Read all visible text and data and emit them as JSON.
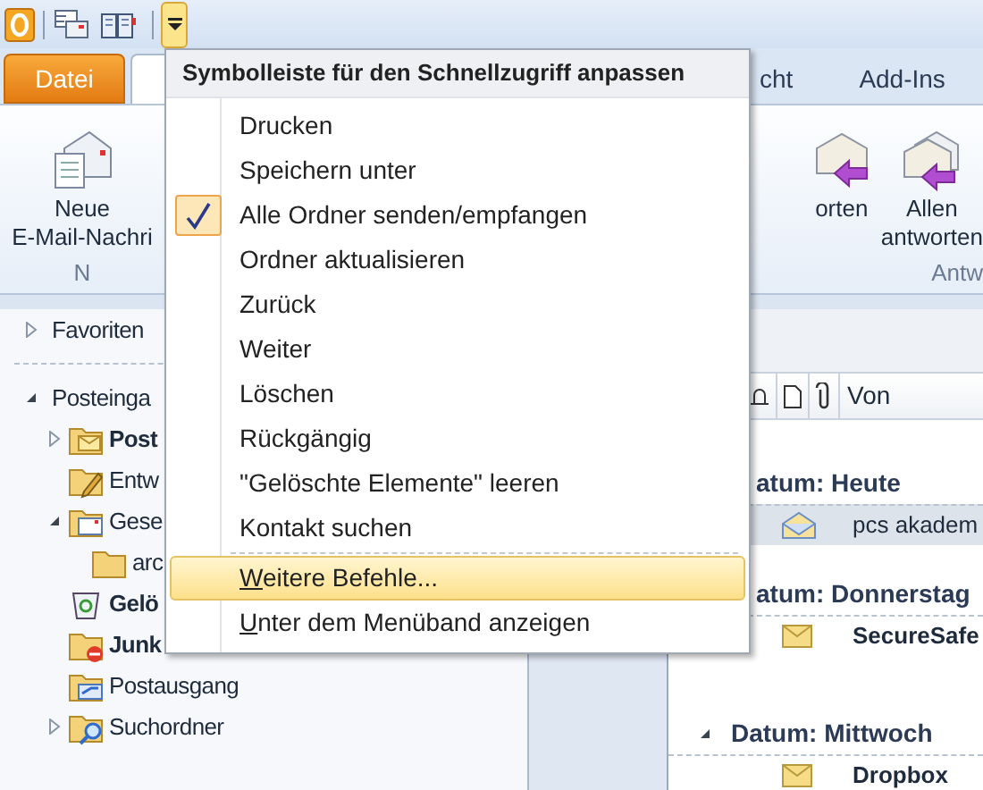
{
  "quick_access_toolbar": {
    "customize_button": {
      "highlighted": true
    }
  },
  "tabs": [
    {
      "label": "Datei",
      "kind": "file"
    },
    {
      "label": "cht",
      "kind": "tab"
    },
    {
      "label": "Add-Ins",
      "kind": "tab"
    }
  ],
  "ribbon": {
    "groups": [
      {
        "label": "N",
        "buttons": [
          {
            "label": "Neue\nE-Mail-Nachri",
            "kind": "new-mail"
          }
        ]
      },
      {
        "label": "Antw",
        "buttons": [
          {
            "label": "orten",
            "kind": "reply"
          },
          {
            "label": "Allen\nantworten",
            "kind": "reply-all"
          }
        ]
      }
    ]
  },
  "navigation": {
    "items": [
      {
        "label": "Favoriten",
        "kind": "header",
        "expanded": false,
        "unread": false
      },
      {
        "label": "Posteinga",
        "kind": "header",
        "expanded": true,
        "unread": false,
        "children": [
          {
            "label": "Post",
            "kind": "inbox",
            "expanded": false,
            "unread": true
          },
          {
            "label": "Entw",
            "kind": "drafts",
            "unread": false
          },
          {
            "label": "Gese",
            "kind": "sent",
            "expanded": true,
            "unread": false,
            "children": [
              {
                "label": "arc",
                "kind": "folder",
                "unread": false
              }
            ]
          },
          {
            "label": "Gelö",
            "kind": "trash",
            "unread": true
          },
          {
            "label": "Junk",
            "kind": "junk",
            "unread": true
          },
          {
            "label": "Postausgang",
            "kind": "outbox",
            "unread": false
          },
          {
            "label": "Suchordner",
            "kind": "search",
            "expanded": false,
            "unread": false
          }
        ]
      }
    ]
  },
  "message_list": {
    "columns": [
      {
        "kind": "bell"
      },
      {
        "kind": "document"
      },
      {
        "kind": "paperclip"
      },
      {
        "kind": "text",
        "label": "Von"
      }
    ],
    "groups": [
      {
        "label": "atum: Heute",
        "label_cut": true,
        "rows": [
          {
            "from": "pcs akadem",
            "read": true,
            "selected": true
          }
        ]
      },
      {
        "label": "atum: Donnerstag",
        "label_cut": true,
        "rows": [
          {
            "from": "SecureSafe",
            "read": false,
            "selected": false
          }
        ]
      },
      {
        "label": "Datum: Mittwoch",
        "label_cut": false,
        "expanded": true,
        "rows": [
          {
            "from": "Dropbox",
            "read": false,
            "selected": false
          }
        ]
      }
    ]
  },
  "menu": {
    "title": "Symbolleiste für den Schnellzugriff anpassen",
    "items": [
      {
        "kind": "item",
        "label": "Drucken",
        "checked": false,
        "selected": false,
        "access_key_underlined": false
      },
      {
        "kind": "item",
        "label": "Speichern unter",
        "checked": false,
        "selected": false,
        "access_key_underlined": false
      },
      {
        "kind": "item",
        "label": "Alle Ordner senden/empfangen",
        "checked": true,
        "selected": false,
        "access_key_underlined": false
      },
      {
        "kind": "item",
        "label": "Ordner aktualisieren",
        "checked": false,
        "selected": false,
        "access_key_underlined": false
      },
      {
        "kind": "item",
        "label": "Zurück",
        "checked": false,
        "selected": false,
        "access_key_underlined": false
      },
      {
        "kind": "item",
        "label": "Weiter",
        "checked": false,
        "selected": false,
        "access_key_underlined": false
      },
      {
        "kind": "item",
        "label": "Löschen",
        "checked": false,
        "selected": false,
        "access_key_underlined": false
      },
      {
        "kind": "item",
        "label": "Rückgängig",
        "checked": false,
        "selected": false,
        "access_key_underlined": false
      },
      {
        "kind": "item",
        "label": "\"Gelöschte Elemente\" leeren",
        "checked": false,
        "selected": false,
        "access_key_underlined": false
      },
      {
        "kind": "item",
        "label": "Kontakt suchen",
        "checked": false,
        "selected": false,
        "access_key_underlined": false
      },
      {
        "kind": "separator"
      },
      {
        "kind": "item",
        "label": "Weitere Befehle...",
        "checked": false,
        "selected": true,
        "access_key_underlined": true
      },
      {
        "kind": "item",
        "label": "Unter dem Menüband anzeigen",
        "checked": false,
        "selected": false,
        "access_key_underlined": true
      }
    ]
  }
}
